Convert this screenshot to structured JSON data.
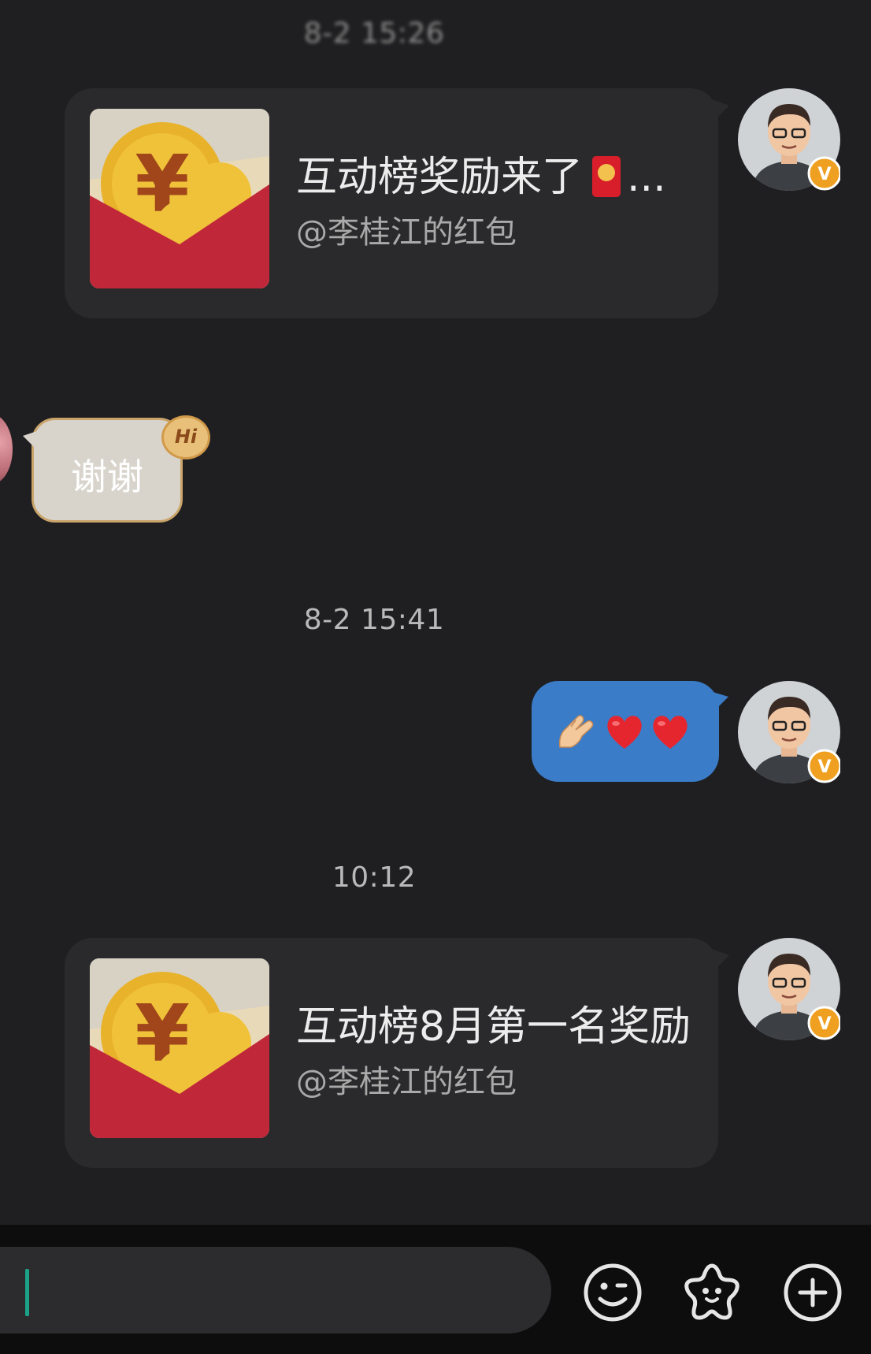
{
  "timestamps": {
    "blurred": "8-2 15:26",
    "first": "8-2 15:41",
    "second": "10:12"
  },
  "messages": {
    "packet_1": {
      "title": "互动榜奖励来了",
      "title_suffix": "...",
      "sender": "@李桂江的红包"
    },
    "thanks": {
      "text": "谢谢",
      "badge": "Hi"
    },
    "emoji_message": {
      "icons": [
        "pinch-hand-icon",
        "red-heart-icon",
        "red-heart-icon"
      ]
    },
    "packet_2": {
      "title": "互动榜8月第一名奖励",
      "sender": "@李桂江的红包"
    }
  },
  "input_bar": {
    "icons": [
      "emoji-icon",
      "sticker-icon",
      "plus-icon"
    ]
  },
  "colors": {
    "background": "#1f1f21",
    "bubble_dark": "#2a2a2c",
    "bubble_blue": "#3a7cc8",
    "red_packet": "#c0283a",
    "coin_gold": "#e8b22a",
    "verified_badge": "#f0a020",
    "cursor": "#1aa389"
  }
}
